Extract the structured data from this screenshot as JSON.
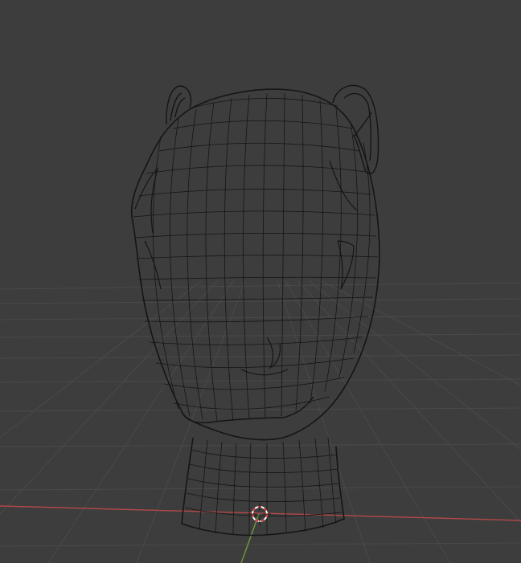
{
  "viewport": {
    "mode": "3d-viewport-wireframe",
    "background_color": "#3d3d3d",
    "grid_color": "#4a4a4a",
    "x_axis_color": "#b54848",
    "y_axis_color": "#6f9a3a",
    "mesh_edge_color": "#151515",
    "object_icon": "head-mesh-wireframe-icon",
    "cursor_icon": "3d-cursor-icon",
    "cursor_colors": [
      "#d83a3a",
      "#ffffff"
    ]
  }
}
